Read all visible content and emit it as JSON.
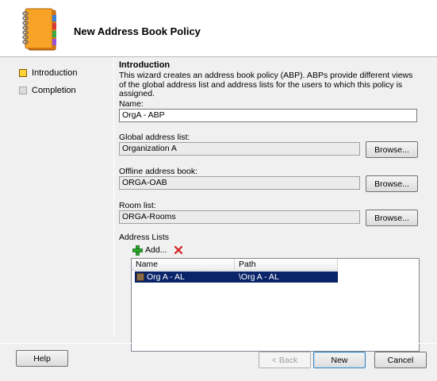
{
  "header": {
    "title": "New Address Book Policy",
    "icon": "address-book-icon"
  },
  "steps": [
    {
      "label": "Introduction",
      "state": "active"
    },
    {
      "label": "Completion",
      "state": "inactive"
    }
  ],
  "intro": {
    "section_title": "Introduction",
    "description": "This wizard creates an address book policy (ABP). ABPs provide different views of the global address list and address lists for the users to which this policy is assigned."
  },
  "fields": {
    "name_label": "Name:",
    "name_value": "OrgA - ABP",
    "gal_label": "Global address list:",
    "gal_value": "Organization A",
    "oab_label": "Offline address book:",
    "oab_value": "ORGA-OAB",
    "room_label": "Room list:",
    "room_value": "ORGA-Rooms",
    "browse_label": "Browse..."
  },
  "address_lists": {
    "label": "Address Lists",
    "add_label": "Add...",
    "columns": [
      "Name",
      "Path"
    ],
    "rows": [
      {
        "name": "Org A - AL",
        "path": "\\Org A - AL",
        "selected": true
      }
    ]
  },
  "footer": {
    "help_label": "Help",
    "back_label": "< Back",
    "new_label": "New",
    "cancel_label": "Cancel"
  },
  "colors": {
    "selection": "#0a246a",
    "active_step": "#ffd23a",
    "remove_icon": "#d42020",
    "add_icon": "#2aa52a"
  }
}
